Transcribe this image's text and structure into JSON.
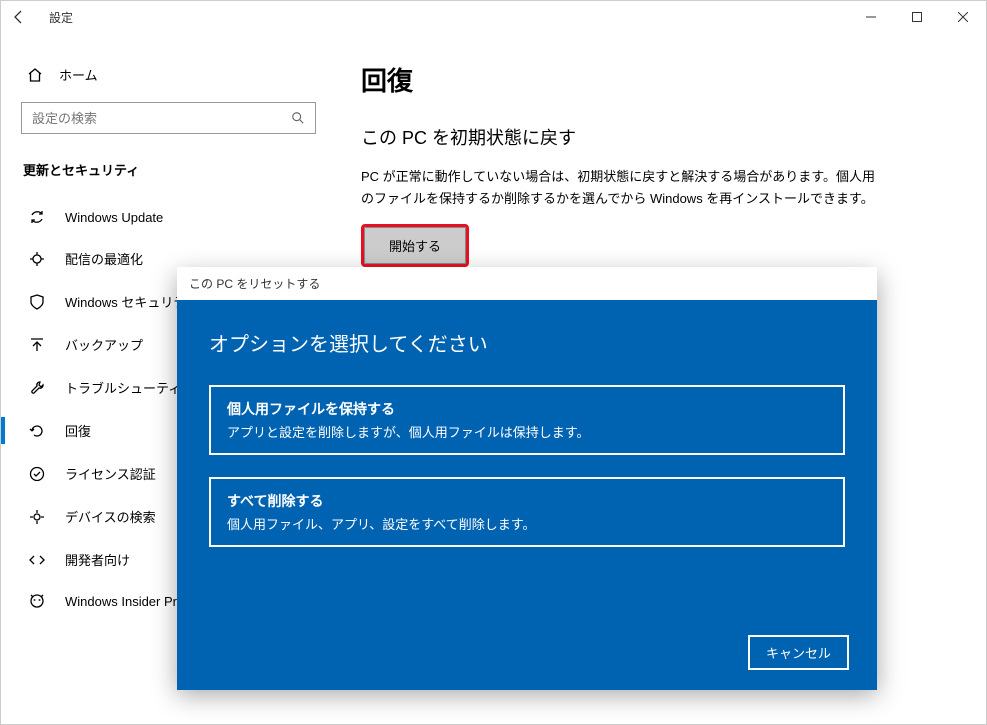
{
  "window": {
    "title": "設定"
  },
  "sidebar": {
    "home_label": "ホーム",
    "search_placeholder": "設定の検索",
    "section_header": "更新とセキュリティ",
    "items": [
      {
        "label": "Windows Update"
      },
      {
        "label": "配信の最適化"
      },
      {
        "label": "Windows セキュリティ"
      },
      {
        "label": "バックアップ"
      },
      {
        "label": "トラブルシューティング"
      },
      {
        "label": "回復"
      },
      {
        "label": "ライセンス認証"
      },
      {
        "label": "デバイスの検索"
      },
      {
        "label": "開発者向け"
      },
      {
        "label": "Windows Insider Program"
      }
    ]
  },
  "main": {
    "page_title": "回復",
    "subsection_title": "この PC を初期状態に戻す",
    "body_text": "PC が正常に動作していない場合は、初期状態に戻すと解決する場合があります。個人用のファイルを保持するか削除するかを選んでから Windows を再インストールできます。",
    "start_button": "開始する"
  },
  "dialog": {
    "title": "この PC をリセットする",
    "heading": "オプションを選択してください",
    "options": [
      {
        "title": "個人用ファイルを保持する",
        "desc": "アプリと設定を削除しますが、個人用ファイルは保持します。"
      },
      {
        "title": "すべて削除する",
        "desc": "個人用ファイル、アプリ、設定をすべて削除します。"
      }
    ],
    "cancel": "キャンセル"
  }
}
